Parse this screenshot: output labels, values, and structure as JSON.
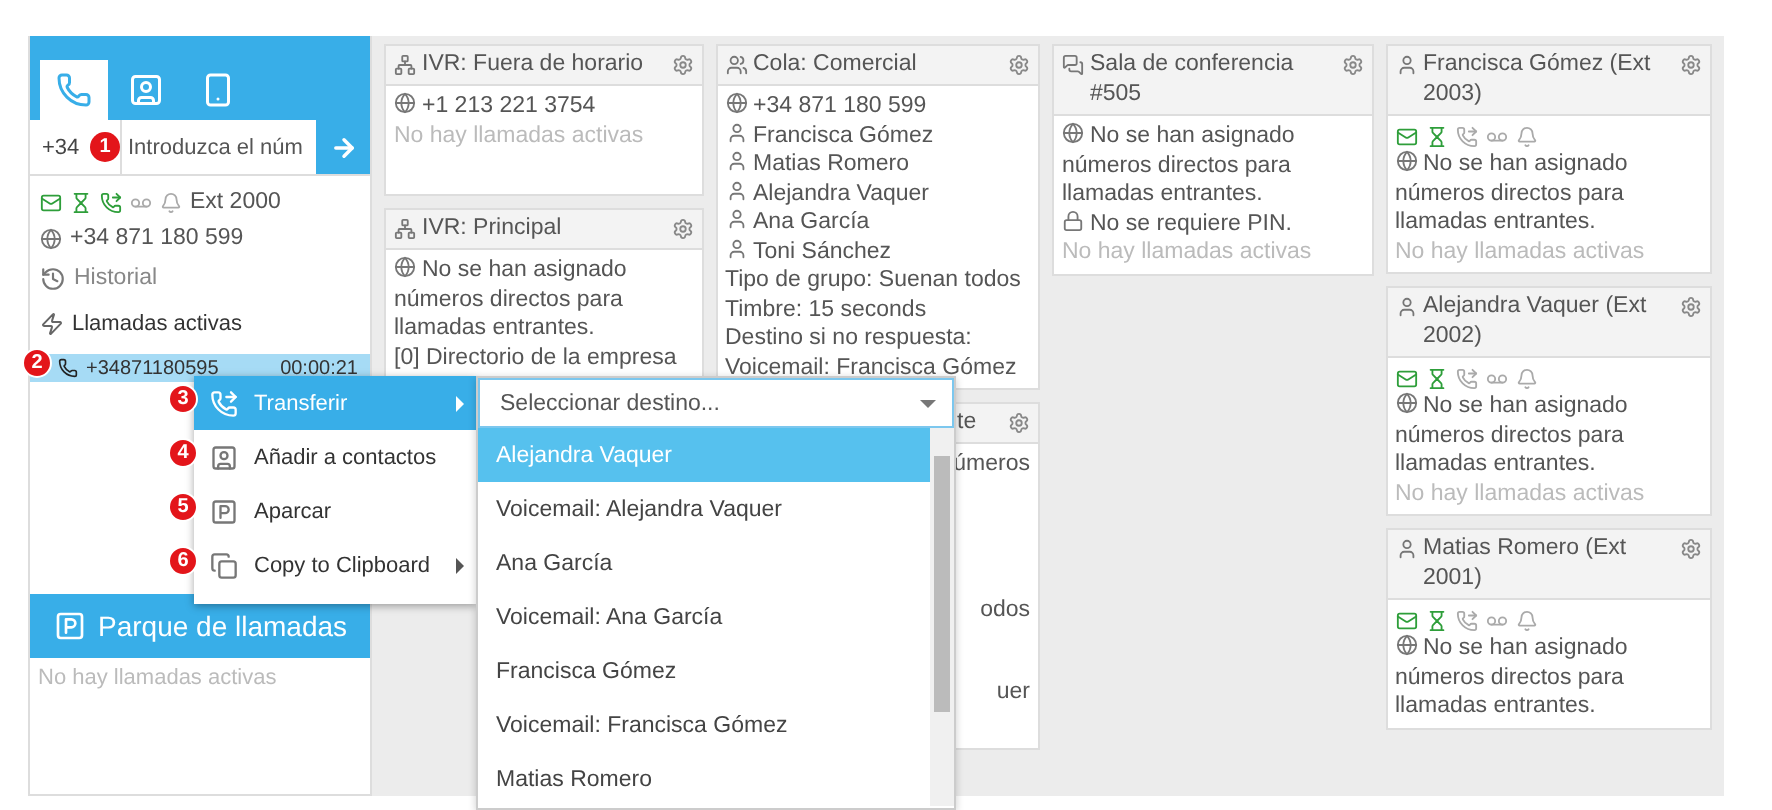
{
  "sidebar": {
    "tabs": [
      {
        "selected": true
      },
      {
        "selected": false
      },
      {
        "selected": false
      }
    ],
    "dial": {
      "prefix": "+34",
      "placeholder": "Introduzca el núm",
      "badge": "1"
    },
    "status": [
      {
        "on": true
      },
      {
        "on": true
      },
      {
        "on": true
      },
      {
        "on": false
      },
      {
        "on": false
      }
    ],
    "extension": "Ext 2000",
    "number": "+34 871 180 599",
    "history": "Historial",
    "active_calls": "Llamadas activas",
    "call": {
      "number": "+34871180595",
      "duration": "00:00:21",
      "selected": true,
      "badge": "2"
    },
    "park": {
      "title": "Parque de llamadas",
      "empty": "No hay llamadas activas"
    }
  },
  "columns": [
    [
      {
        "kind": "ivr",
        "title": "IVR: Fuera de horario",
        "lines": [
          {
            "kind": "globe",
            "text": "+1 213 221 3754"
          },
          {
            "kind": "muted",
            "text": "No hay llamadas activas"
          }
        ]
      },
      {
        "kind": "ivr",
        "title": "IVR: Principal",
        "lines": [
          {
            "kind": "globe",
            "text": "No se han asignado números directos para llamadas entrantes."
          },
          {
            "kind": "text",
            "text": "[0] Directorio de la empresa"
          }
        ]
      }
    ],
    [
      {
        "kind": "queue",
        "title": "Cola: Comercial",
        "lines": [
          {
            "kind": "globe",
            "text": "+34 871 180 599"
          },
          {
            "kind": "person",
            "text": "Francisca Gómez"
          },
          {
            "kind": "person",
            "text": "Matias Romero"
          },
          {
            "kind": "person",
            "text": "Alejandra Vaquer"
          },
          {
            "kind": "person",
            "text": "Ana García"
          },
          {
            "kind": "person",
            "text": "Toni Sánchez"
          },
          {
            "kind": "text",
            "text": "Tipo de grupo: Suenan todos"
          },
          {
            "kind": "text",
            "text": "Timbre: 15 seconds"
          },
          {
            "kind": "text",
            "text": "Destino si no respuesta:"
          },
          {
            "kind": "text",
            "text": "Voicemail: Francisca Gómez"
          }
        ]
      },
      {
        "kind": "partial",
        "title": "te",
        "lines": [
          {
            "kind": "text",
            "text": "úmeros"
          },
          {
            "kind": "text",
            "text": "odos"
          },
          {
            "kind": "text",
            "text": "uer"
          }
        ]
      }
    ],
    [
      {
        "kind": "conference",
        "title": "Sala de conferencia #505",
        "lines": [
          {
            "kind": "globe",
            "text": "No se han asignado números directos para llamadas entrantes."
          },
          {
            "kind": "lock",
            "text": "No se requiere PIN."
          },
          {
            "kind": "muted",
            "text": "No hay llamadas activas"
          }
        ]
      }
    ],
    [
      {
        "kind": "user",
        "title": "Francisca Gómez (Ext 2003)",
        "status": [
          {
            "on": true
          },
          {
            "on": true
          },
          {
            "on": false
          },
          {
            "on": false
          },
          {
            "on": false
          }
        ],
        "lines": [
          {
            "kind": "globe",
            "text": "No se han asignado números directos para llamadas entrantes."
          },
          {
            "kind": "muted",
            "text": "No hay llamadas activas"
          }
        ]
      },
      {
        "kind": "user",
        "title": "Alejandra Vaquer (Ext 2002)",
        "status": [
          {
            "on": true
          },
          {
            "on": true
          },
          {
            "on": false
          },
          {
            "on": false
          },
          {
            "on": false
          }
        ],
        "lines": [
          {
            "kind": "globe",
            "text": "No se han asignado números directos para llamadas entrantes."
          },
          {
            "kind": "muted",
            "text": "No hay llamadas activas"
          }
        ]
      },
      {
        "kind": "user",
        "title": "Matias Romero (Ext 2001)",
        "status": [
          {
            "on": true
          },
          {
            "on": true
          },
          {
            "on": false
          },
          {
            "on": false
          },
          {
            "on": false
          }
        ],
        "lines": [
          {
            "kind": "globe",
            "text": "No se han asignado números directos para llamadas entrantes."
          }
        ]
      }
    ]
  ],
  "context_menu": [
    {
      "kind": "transfer",
      "label": "Transferir",
      "badge": "3",
      "submenu": true,
      "selected": true
    },
    {
      "kind": "contact",
      "label": "Añadir a contactos",
      "badge": "4",
      "submenu": false,
      "selected": false
    },
    {
      "kind": "park",
      "label": "Aparcar",
      "badge": "5",
      "submenu": false,
      "selected": false
    },
    {
      "kind": "clipboard",
      "label": "Copy to Clipboard",
      "badge": "6",
      "submenu": true,
      "selected": false
    }
  ],
  "transfer_select": {
    "placeholder": "Seleccionar destino...",
    "options": [
      {
        "label": "Alejandra Vaquer",
        "selected": true
      },
      {
        "label": "Voicemail: Alejandra Vaquer",
        "selected": false
      },
      {
        "label": "Ana García",
        "selected": false
      },
      {
        "label": "Voicemail: Ana García",
        "selected": false
      },
      {
        "label": "Francisca Gómez",
        "selected": false
      },
      {
        "label": "Voicemail: Francisca Gómez",
        "selected": false
      },
      {
        "label": "Matias Romero",
        "selected": false
      }
    ]
  }
}
